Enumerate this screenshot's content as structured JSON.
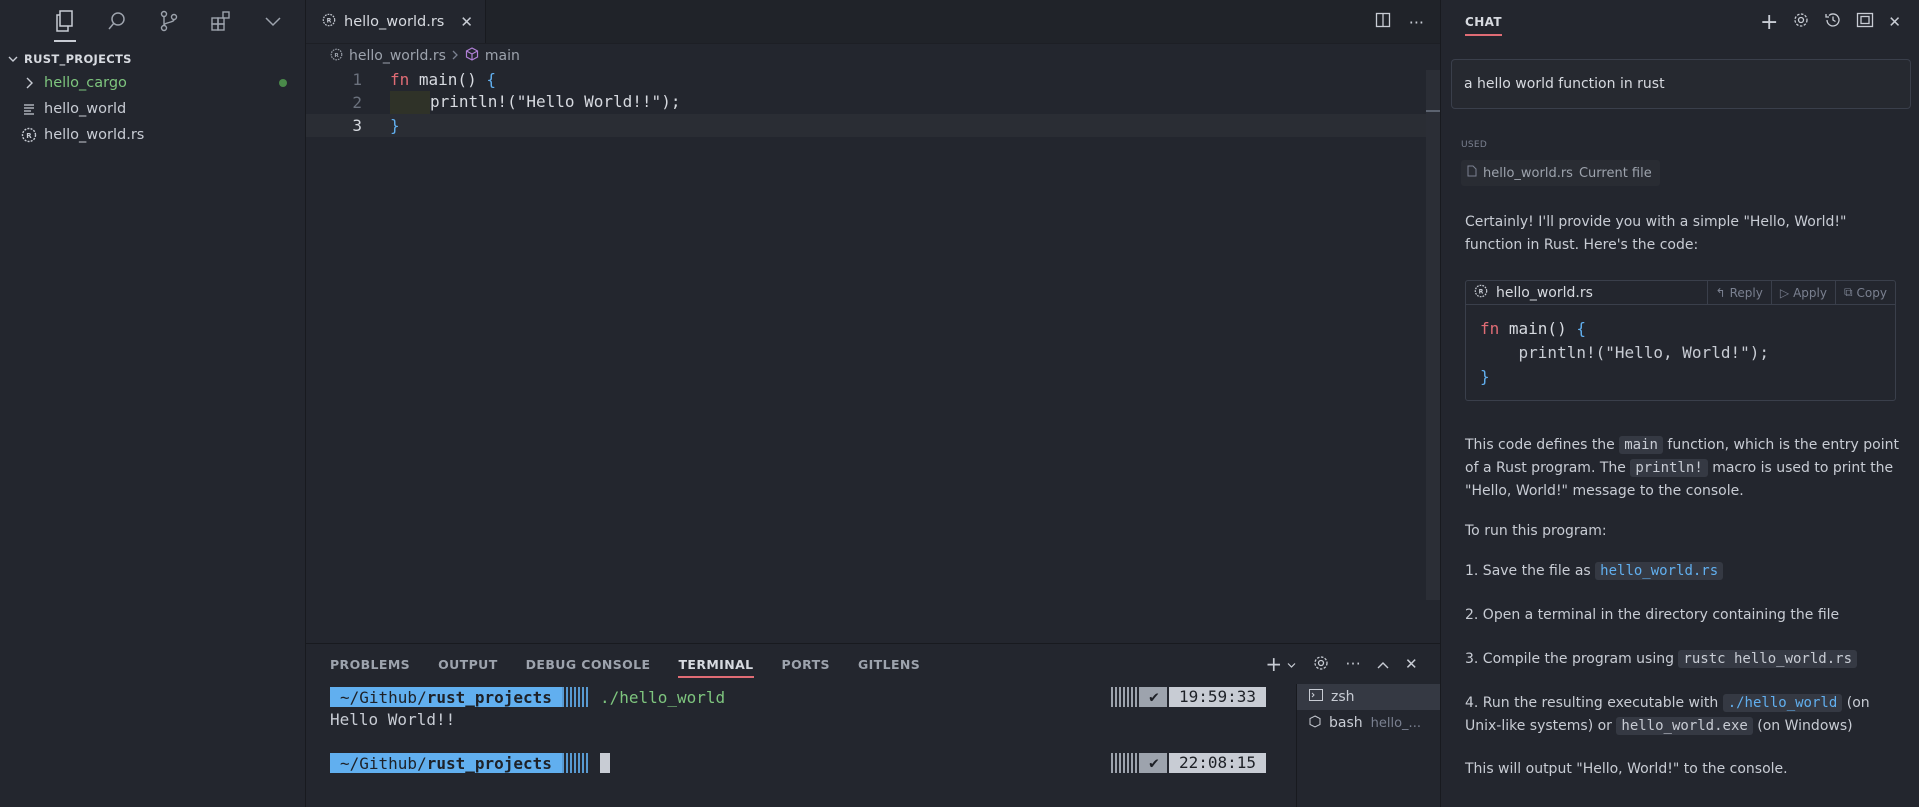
{
  "sidebar": {
    "section_title": "RUST_PROJECTS",
    "items": [
      {
        "label": "hello_cargo",
        "icon": "chevron-right-icon"
      },
      {
        "label": "hello_world",
        "icon": "binary-file-icon"
      },
      {
        "label": "hello_world.rs",
        "icon": "rust-file-icon"
      }
    ]
  },
  "editor": {
    "tab_label": "hello_world.rs",
    "breadcrumb": {
      "file": "hello_world.rs",
      "symbol": "main"
    },
    "lines": [
      {
        "number": "1",
        "kw": "fn",
        "name": " main() ",
        "brace": "{"
      },
      {
        "number": "2",
        "text": "println!(\"Hello World!!\");"
      },
      {
        "number": "3",
        "brace": "}"
      }
    ]
  },
  "panel": {
    "tabs": [
      "PROBLEMS",
      "OUTPUT",
      "DEBUG CONSOLE",
      "TERMINAL",
      "PORTS",
      "GITLENS"
    ],
    "terminal": {
      "prompt_path": "~/Github/",
      "prompt_dir": "rust_projects",
      "command": "./hello_world",
      "output": "Hello World!!",
      "check": "✔",
      "time1": "19:59:33",
      "time2": "22:08:15"
    },
    "terminals": [
      {
        "name": "zsh",
        "sub": ""
      },
      {
        "name": "bash",
        "sub": "hello_..."
      }
    ]
  },
  "chat": {
    "title": "CHAT",
    "query": "a hello world function in rust",
    "used_label": "USED",
    "used_file": "hello_world.rs",
    "used_note": "Current file",
    "intro": "Certainly! I'll provide you with a simple \"Hello, World!\" function in Rust. Here's the code:",
    "snippet": {
      "file": "hello_world.rs",
      "reply": "Reply",
      "apply": "Apply",
      "copy": "Copy",
      "line1_kw": "fn",
      "line1_rest": " main() ",
      "line2": "    println!(\"Hello, World!\");"
    },
    "explain": {
      "a": "This code defines the ",
      "main_chip": "main",
      "b": " function, which is the entry point of a Rust program. The ",
      "println_chip": "println!",
      "c": " macro is used to print the \"Hello, World!\" message to the console."
    },
    "run_title": "To run this program:",
    "step1": {
      "a": "1. Save the file as ",
      "chip": "hello_world.rs"
    },
    "step2": "2. Open a terminal in the directory containing the file",
    "step3": {
      "a": "3. Compile the program using ",
      "chip": "rustc hello_world.rs"
    },
    "step4": {
      "a": "4. Run the resulting executable with ",
      "chip1": "./hello_world",
      "b": " (on Unix-like systems) or ",
      "chip2": "hello_world.exe",
      "c": " (on Windows)"
    },
    "outro": "This will output \"Hello, World!\" to the console."
  }
}
